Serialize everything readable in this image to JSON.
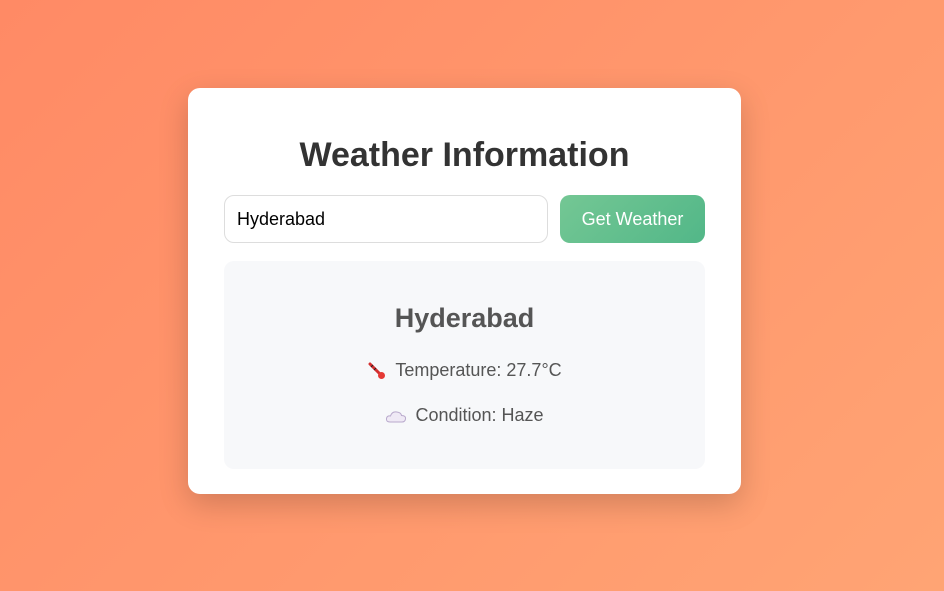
{
  "colors": {
    "background_start": "#ff8a65",
    "background_end": "#ffa474",
    "button_start": "#74c794",
    "button_end": "#52b788",
    "title": "#333333",
    "text": "#555555"
  },
  "header": {
    "title": "Weather Information"
  },
  "search": {
    "value": "Hyderabad",
    "button_label": "Get Weather"
  },
  "result": {
    "city": "Hyderabad",
    "temperature": {
      "icon": "thermometer-icon",
      "text": "Temperature: 27.7°C"
    },
    "condition": {
      "icon": "cloud-icon",
      "text": "Condition: Haze"
    }
  }
}
